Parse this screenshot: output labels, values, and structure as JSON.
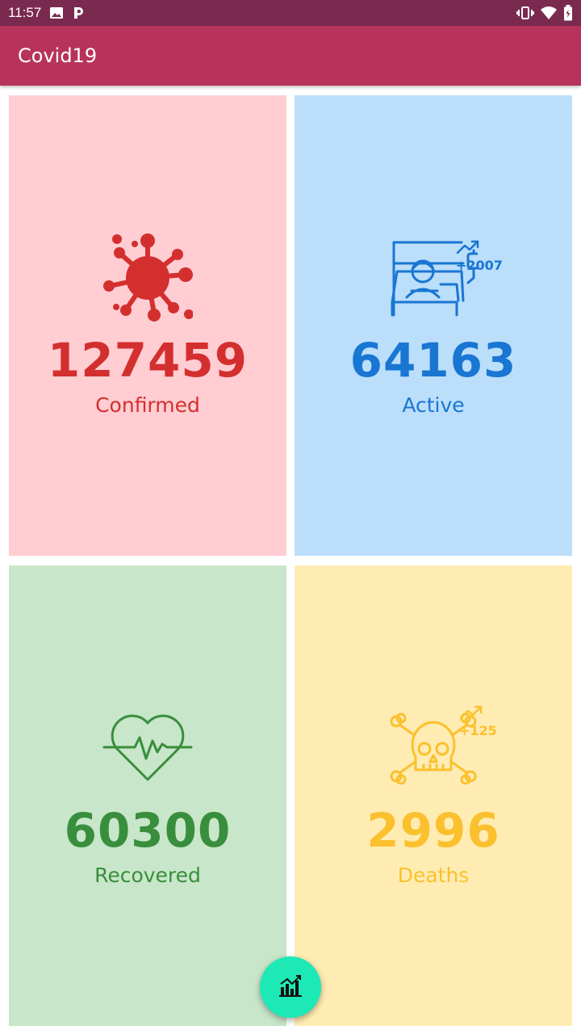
{
  "status_bar": {
    "time": "11:57",
    "icons": [
      "image-icon",
      "parking-icon",
      "vibrate-icon",
      "wifi-icon",
      "battery-icon"
    ]
  },
  "app_bar": {
    "title": "Covid19"
  },
  "cards": {
    "confirmed": {
      "count": "127459",
      "label": "Confirmed",
      "icon": "virus-icon",
      "color": "#d32f2f",
      "background": "#ffcdd2"
    },
    "active": {
      "count": "64163",
      "label": "Active",
      "icon": "hospital-bed-icon",
      "delta": "+2007",
      "color": "#1976d2",
      "background": "#bbdefb"
    },
    "recovered": {
      "count": "60300",
      "label": "Recovered",
      "icon": "heartbeat-icon",
      "color": "#388e3c",
      "background": "#c8e6c9"
    },
    "deaths": {
      "count": "2996",
      "label": "Deaths",
      "icon": "skull-crossbones-icon",
      "delta": "+125",
      "color": "#fbc02d",
      "background": "#ffecb3"
    }
  },
  "fab": {
    "icon": "chart-icon",
    "color": "#1de9b6"
  }
}
